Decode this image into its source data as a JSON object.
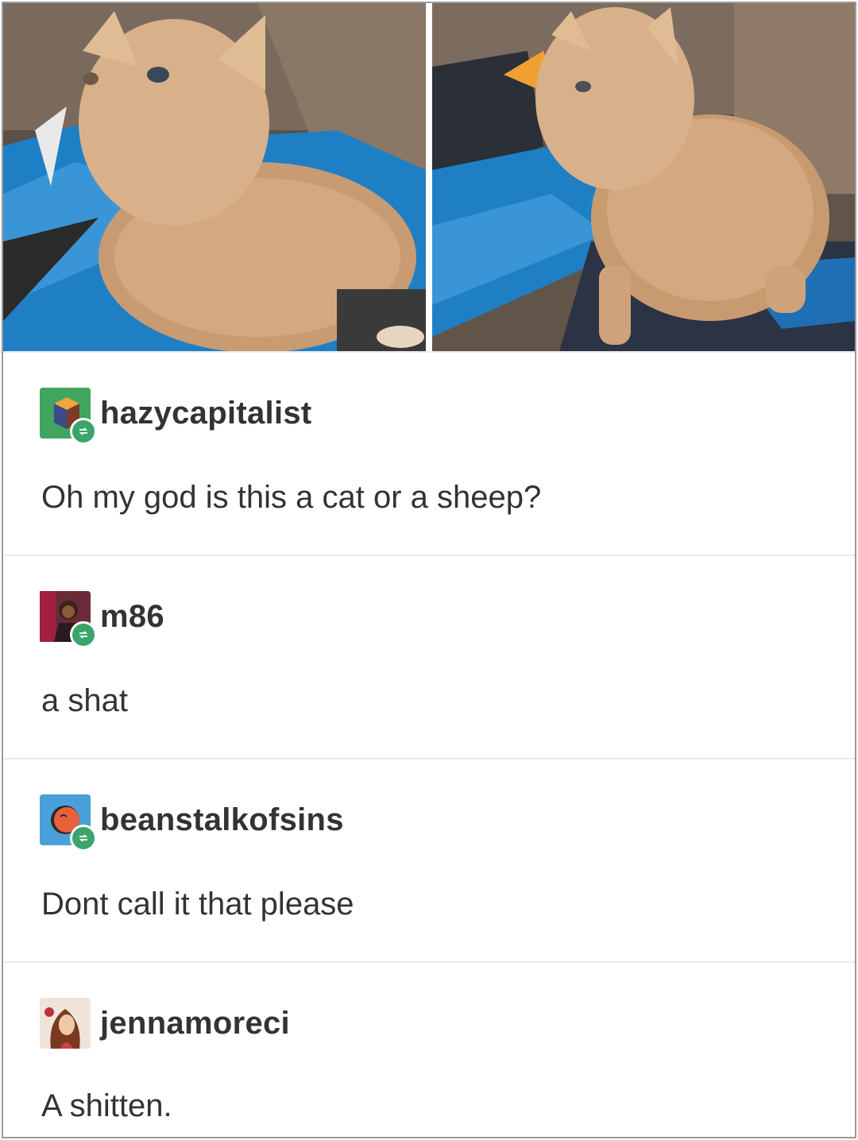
{
  "photos": [
    {
      "icon": "kitten-photo-left"
    },
    {
      "icon": "kitten-photo-right"
    }
  ],
  "thread": [
    {
      "username": "hazycapitalist",
      "text": "Oh my god is this a cat or a sheep?",
      "avatar_icon": "cube-avatar"
    },
    {
      "username": "m86",
      "text": "a shat",
      "avatar_icon": "person-avatar"
    },
    {
      "username": "beanstalkofsins",
      "text": "Dont call it that please",
      "avatar_icon": "orange-circle-avatar"
    },
    {
      "username": "jennamoreci",
      "text": "A shitten.",
      "avatar_icon": "woman-avatar"
    }
  ],
  "colors": {
    "reblog_badge": "#3aa56b",
    "text": "#333333",
    "divider": "#ebebeb"
  }
}
